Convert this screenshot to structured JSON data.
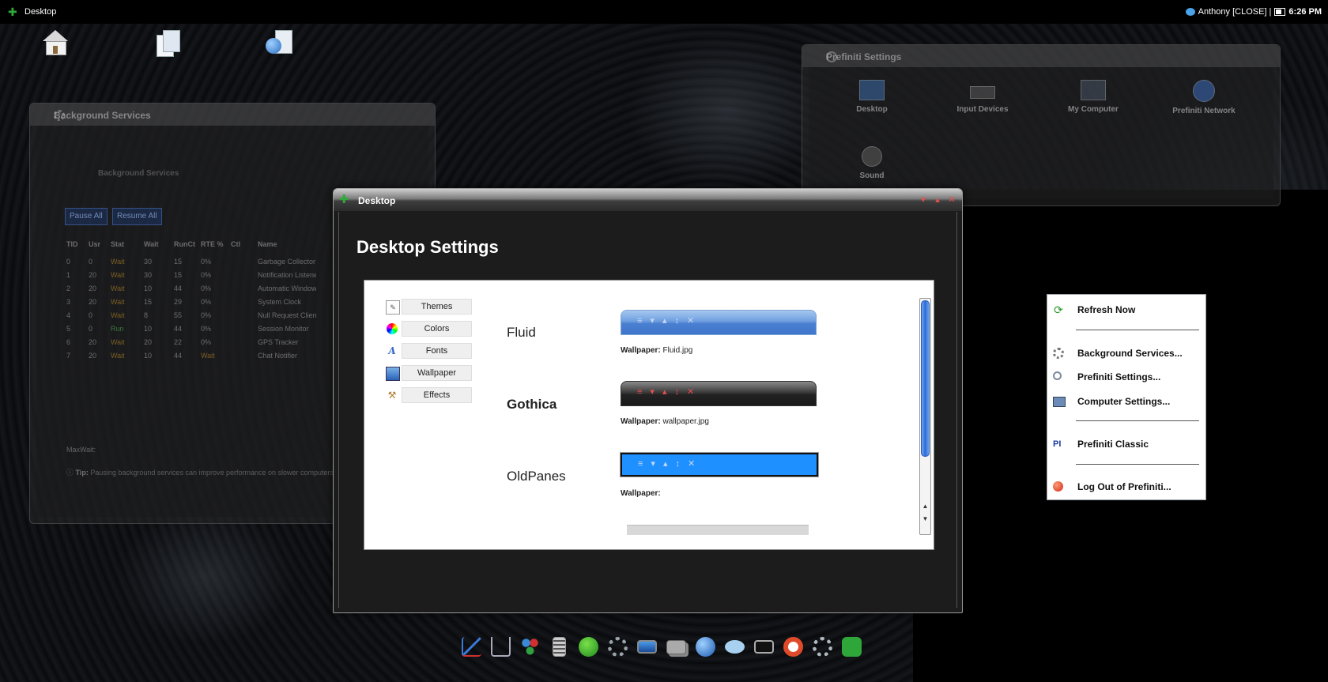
{
  "topbar": {
    "app_title": "Desktop",
    "user_text": "Anthony [CLOSE] |",
    "time": "6:26 PM"
  },
  "desktop_icons": [
    "home-icon",
    "documents-icon",
    "network-icon"
  ],
  "background_services_window": {
    "title": "Background Services",
    "subtitle": "Background Services",
    "buttons": [
      "Pause All",
      "Resume All"
    ],
    "columns": [
      "TID",
      "Usr",
      "Stat",
      "Wait",
      "RunCt",
      "RTE %",
      "Ctl",
      "Name"
    ],
    "rows": [
      [
        "0",
        "0",
        "Wait",
        "30",
        "15",
        "0%",
        "",
        "Garbage Collector"
      ],
      [
        "1",
        "20",
        "Wait",
        "30",
        "15",
        "0%",
        "",
        "Notification Listener"
      ],
      [
        "2",
        "20",
        "Wait",
        "10",
        "44",
        "0%",
        "",
        "Automatic Window"
      ],
      [
        "3",
        "20",
        "Wait",
        "15",
        "29",
        "0%",
        "",
        "System Clock"
      ],
      [
        "4",
        "0",
        "Wait",
        "8",
        "55",
        "0%",
        "",
        "Null Request Client"
      ],
      [
        "5",
        "0",
        "Run",
        "10",
        "44",
        "0%",
        "",
        "Session Monitor"
      ],
      [
        "6",
        "20",
        "Wait",
        "20",
        "22",
        "0%",
        "",
        "GPS Tracker"
      ],
      [
        "7",
        "20",
        "Wait",
        "10",
        "44",
        "Wait",
        "",
        "Chat Notifier"
      ]
    ],
    "footer": "MaxWait:",
    "tip_label": "Tip:",
    "tip_text": "Pausing background services can improve performance on slower computers."
  },
  "preferences_window": {
    "title": "Prefiniti Settings",
    "items": [
      "Desktop",
      "Input Devices",
      "My Computer",
      "Prefiniti Network",
      "Sound"
    ]
  },
  "desktop_window": {
    "title": "Desktop",
    "heading": "Desktop Settings",
    "menu": [
      {
        "label": "Themes",
        "icon": "themes-icon"
      },
      {
        "label": "Colors",
        "icon": "colors-icon"
      },
      {
        "label": "Fonts",
        "icon": "fonts-icon"
      },
      {
        "label": "Wallpaper",
        "icon": "wallpaper-icon"
      },
      {
        "label": "Effects",
        "icon": "effects-icon"
      }
    ],
    "themes": [
      {
        "name": "Fluid",
        "wallpaper_label": "Wallpaper:",
        "wallpaper_file": "Fluid.jpg"
      },
      {
        "name": "Gothica",
        "wallpaper_label": "Wallpaper:",
        "wallpaper_file": "wallpaper.jpg"
      },
      {
        "name": "OldPanes",
        "wallpaper_label": "Wallpaper:",
        "wallpaper_file": ""
      }
    ],
    "controls": {
      "minimize": "▾",
      "maximize": "▴",
      "close": "✕"
    },
    "preview_controls": [
      "≡",
      "▾",
      "▴",
      "↕",
      "✕"
    ]
  },
  "context_menu": {
    "items": [
      {
        "label": "Refresh Now",
        "icon": "refresh-icon"
      },
      {
        "label": "Background Services...",
        "icon": "gear-icon"
      },
      {
        "label": "Prefiniti Settings...",
        "icon": "search-icon"
      },
      {
        "label": "Computer Settings...",
        "icon": "computer-icon"
      },
      {
        "label": "Prefiniti Classic",
        "icon": "classic-icon"
      },
      {
        "label": "Log Out of Prefiniti...",
        "icon": "logout-icon"
      }
    ]
  },
  "dock": [
    "chart-icon",
    "cart-icon",
    "people-icon",
    "calculator-icon",
    "run-icon",
    "gear-icon",
    "screen-icon",
    "windows-icon",
    "globe-icon",
    "chat-icon",
    "terminal-icon",
    "help-ring-icon",
    "settings-icon",
    "puzzle-icon"
  ],
  "colors": {
    "accent_green": "#2eaa3a",
    "close_red": "#e85050",
    "fluid_blue": "#4a7fd0",
    "oldpanes_blue": "#1e90ff"
  }
}
